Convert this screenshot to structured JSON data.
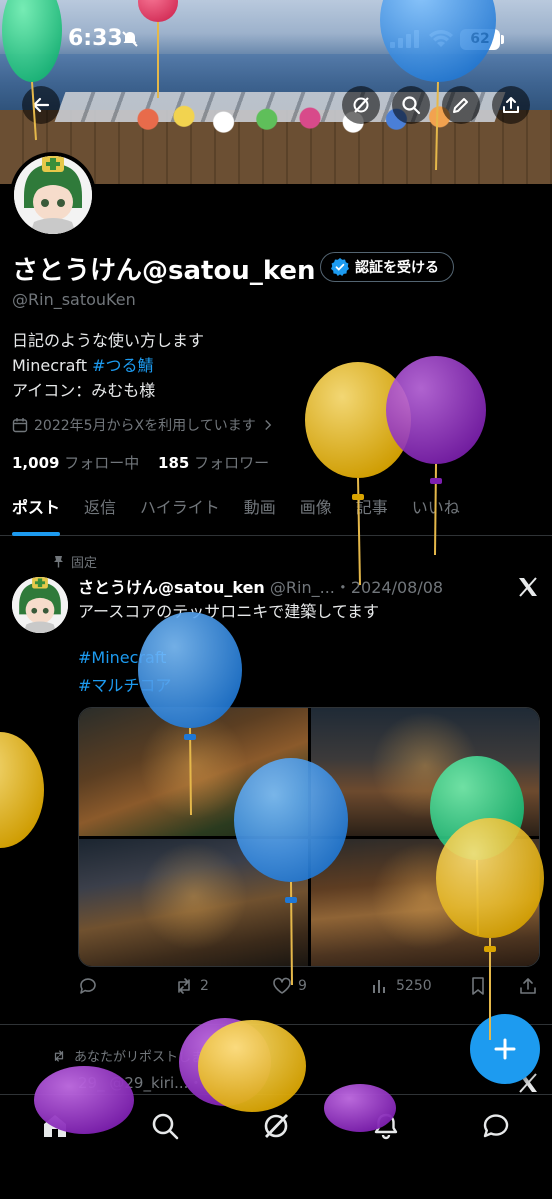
{
  "status_bar": {
    "time": "6:33",
    "battery": "62"
  },
  "profile": {
    "name": "さとうけん@satou_ken",
    "verify_label": "認証を受ける",
    "handle": "@Rin_satouKen",
    "bio_line1": "日記のような使い方します",
    "bio_line2_prefix": "Minecraft ",
    "bio_line2_tag": "#つる鯖",
    "bio_line3": "アイコン：みむも様",
    "joined": "2022年5月からXを利用しています",
    "following_count": "1,009",
    "following_label": "フォロー中",
    "followers_count": "185",
    "followers_label": "フォロワー"
  },
  "tabs": [
    "ポスト",
    "返信",
    "ハイライト",
    "動画",
    "画像",
    "記事",
    "いいね"
  ],
  "pinned_post": {
    "pinned_label": "固定",
    "author": "さとうけん@satou_ken",
    "meta": "@Rin_...・2024/08/08",
    "text": "アースコアのテッサロニキで建築してます",
    "tags": [
      "#Minecraft",
      "#マルチコア"
    ],
    "retweets": "2",
    "likes": "9",
    "views": "5250"
  },
  "next_post": {
    "repost_label": "あなたがリポストしました",
    "header": "29_ @29_kiri...・18時間"
  },
  "colors": {
    "accent": "#1d9bf0",
    "background": "#000000",
    "muted": "#71767b"
  },
  "icons": [
    "back-arrow-icon",
    "grok-icon",
    "search-icon",
    "edit-icon",
    "share-icon",
    "verified-badge-icon",
    "calendar-icon",
    "pin-icon",
    "x-logo-icon",
    "reply-icon",
    "repost-icon",
    "like-icon",
    "views-icon",
    "bookmark-icon",
    "plus-icon",
    "home-icon",
    "bell-icon",
    "messages-icon"
  ]
}
